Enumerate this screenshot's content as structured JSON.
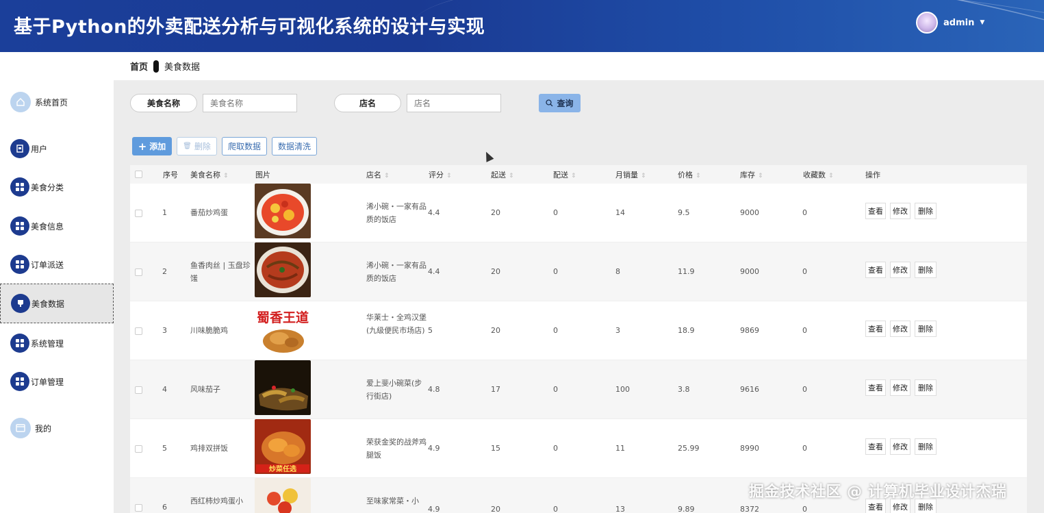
{
  "header": {
    "title": "基于Python的外卖配送分析与可视化系统的设计与实现",
    "username": "admin"
  },
  "breadcrumb": {
    "home": "首页",
    "current": "美食数据"
  },
  "sidebar": {
    "items": [
      {
        "label": "系统首页",
        "icon": "home-icon"
      },
      {
        "label": "用户",
        "icon": "user-badge-icon"
      },
      {
        "label": "美食分类",
        "icon": "grid-icon"
      },
      {
        "label": "美食信息",
        "icon": "grid-icon"
      },
      {
        "label": "订单派送",
        "icon": "grid-icon"
      },
      {
        "label": "美食数据",
        "icon": "cup-icon"
      },
      {
        "label": "系统管理",
        "icon": "grid-icon"
      },
      {
        "label": "订单管理",
        "icon": "grid-icon"
      },
      {
        "label": "我的",
        "icon": "card-icon"
      }
    ]
  },
  "search": {
    "name_label": "美食名称",
    "name_placeholder": "美食名称",
    "shop_label": "店名",
    "shop_placeholder": "店名",
    "query_label": "查询"
  },
  "toolbar": {
    "add": "添加",
    "delete": "删除",
    "crawl": "爬取数据",
    "clean": "数据清洗"
  },
  "table": {
    "headers": {
      "index": "序号",
      "name": "美食名称",
      "image": "图片",
      "shop": "店名",
      "rating": "评分",
      "min_order": "起送",
      "delivery": "配送",
      "monthly_sales": "月销量",
      "price": "价格",
      "stock": "库存",
      "favorites": "收藏数",
      "actions": "操作"
    },
    "action_labels": {
      "view": "查看",
      "edit": "修改",
      "delete": "删除"
    },
    "rows": [
      {
        "index": "1",
        "name": "番茄炒鸡蛋",
        "shop": "浠小碗・一家有品质的饭店",
        "rating": "4.4",
        "min_order": "20",
        "delivery": "0",
        "monthly_sales": "14",
        "price": "9.5",
        "stock": "9000",
        "favorites": "0"
      },
      {
        "index": "2",
        "name": "鱼香肉丝 | 玉盘珍馐",
        "shop": "浠小碗・一家有品质的饭店",
        "rating": "4.4",
        "min_order": "20",
        "delivery": "0",
        "monthly_sales": "8",
        "price": "11.9",
        "stock": "9000",
        "favorites": "0"
      },
      {
        "index": "3",
        "name": "川味脆脆鸡",
        "shop": "华莱士・全鸡汉堡(九级便民市场店)",
        "rating": "5",
        "min_order": "20",
        "delivery": "0",
        "monthly_sales": "3",
        "price": "18.9",
        "stock": "9869",
        "favorites": "0",
        "image_text": "蜀香王道"
      },
      {
        "index": "4",
        "name": "风味茄子",
        "shop": "爱上斐小碗菜(步行街店)",
        "rating": "4.8",
        "min_order": "17",
        "delivery": "0",
        "monthly_sales": "100",
        "price": "3.8",
        "stock": "9616",
        "favorites": "0"
      },
      {
        "index": "5",
        "name": "鸡排双拼饭",
        "shop": "荣获金奖的战斧鸡腿饭",
        "rating": "4.9",
        "min_order": "15",
        "delivery": "0",
        "monthly_sales": "11",
        "price": "25.99",
        "stock": "8990",
        "favorites": "0",
        "image_text": "炒菜任选"
      },
      {
        "index": "6",
        "name": "西红柿炒鸡蛋小",
        "shop": "至味家常菜・小",
        "rating": "4.9",
        "min_order": "20",
        "delivery": "0",
        "monthly_sales": "13",
        "price": "9.89",
        "stock": "8372",
        "favorites": "0"
      }
    ]
  },
  "watermark": "掘金技术社区 @ 计算机毕业设计杰瑞"
}
